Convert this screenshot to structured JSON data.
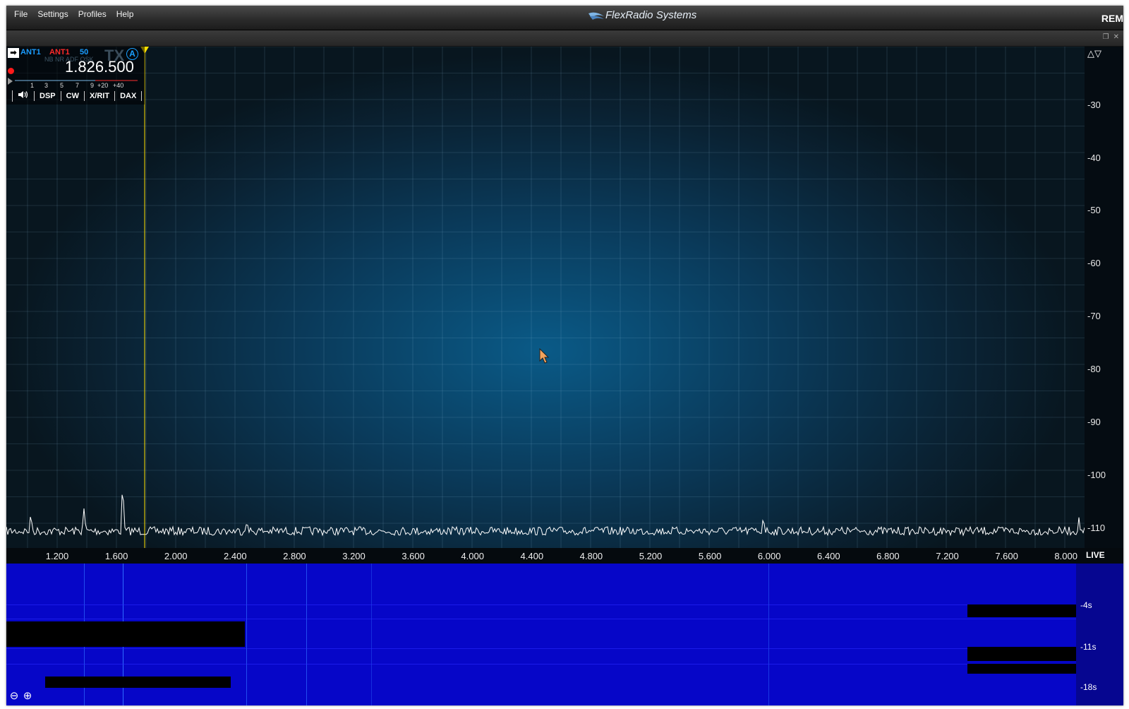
{
  "menu": [
    "File",
    "Settings",
    "Profiles",
    "Help"
  ],
  "brand": "FlexRadio Systems",
  "rem_label": "REM",
  "slice": {
    "ant_rx": "ANT1",
    "ant_tx": "ANT1",
    "rx_filter": "50",
    "flags": "NB NR ADF QSK",
    "tx_label": "TX",
    "slice_letter": "A",
    "frequency": "1.826.500",
    "smeter_scale": [
      "1",
      "3",
      "5",
      "7",
      "9",
      "+20",
      "+40"
    ],
    "buttons": [
      "DSP",
      "CW",
      "X/RIT",
      "DAX"
    ]
  },
  "db_scale": [
    "-30",
    "-40",
    "-50",
    "-60",
    "-70",
    "-80",
    "-90",
    "-100",
    "-110"
  ],
  "freq_axis": [
    "1.200",
    "1.600",
    "2.000",
    "2.400",
    "2.800",
    "3.200",
    "3.600",
    "4.000",
    "4.400",
    "4.800",
    "5.200",
    "5.600",
    "6.000",
    "6.400",
    "6.800",
    "7.200",
    "7.600",
    "8.000"
  ],
  "live_label": "LIVE",
  "waterfall_times": [
    "-4s",
    "-11s",
    "-18s"
  ],
  "colors": {
    "panadapter": "#0a5a87",
    "waterfall": "#0606c8",
    "trace": "#ffffff",
    "slice_marker": "#ffe000"
  }
}
